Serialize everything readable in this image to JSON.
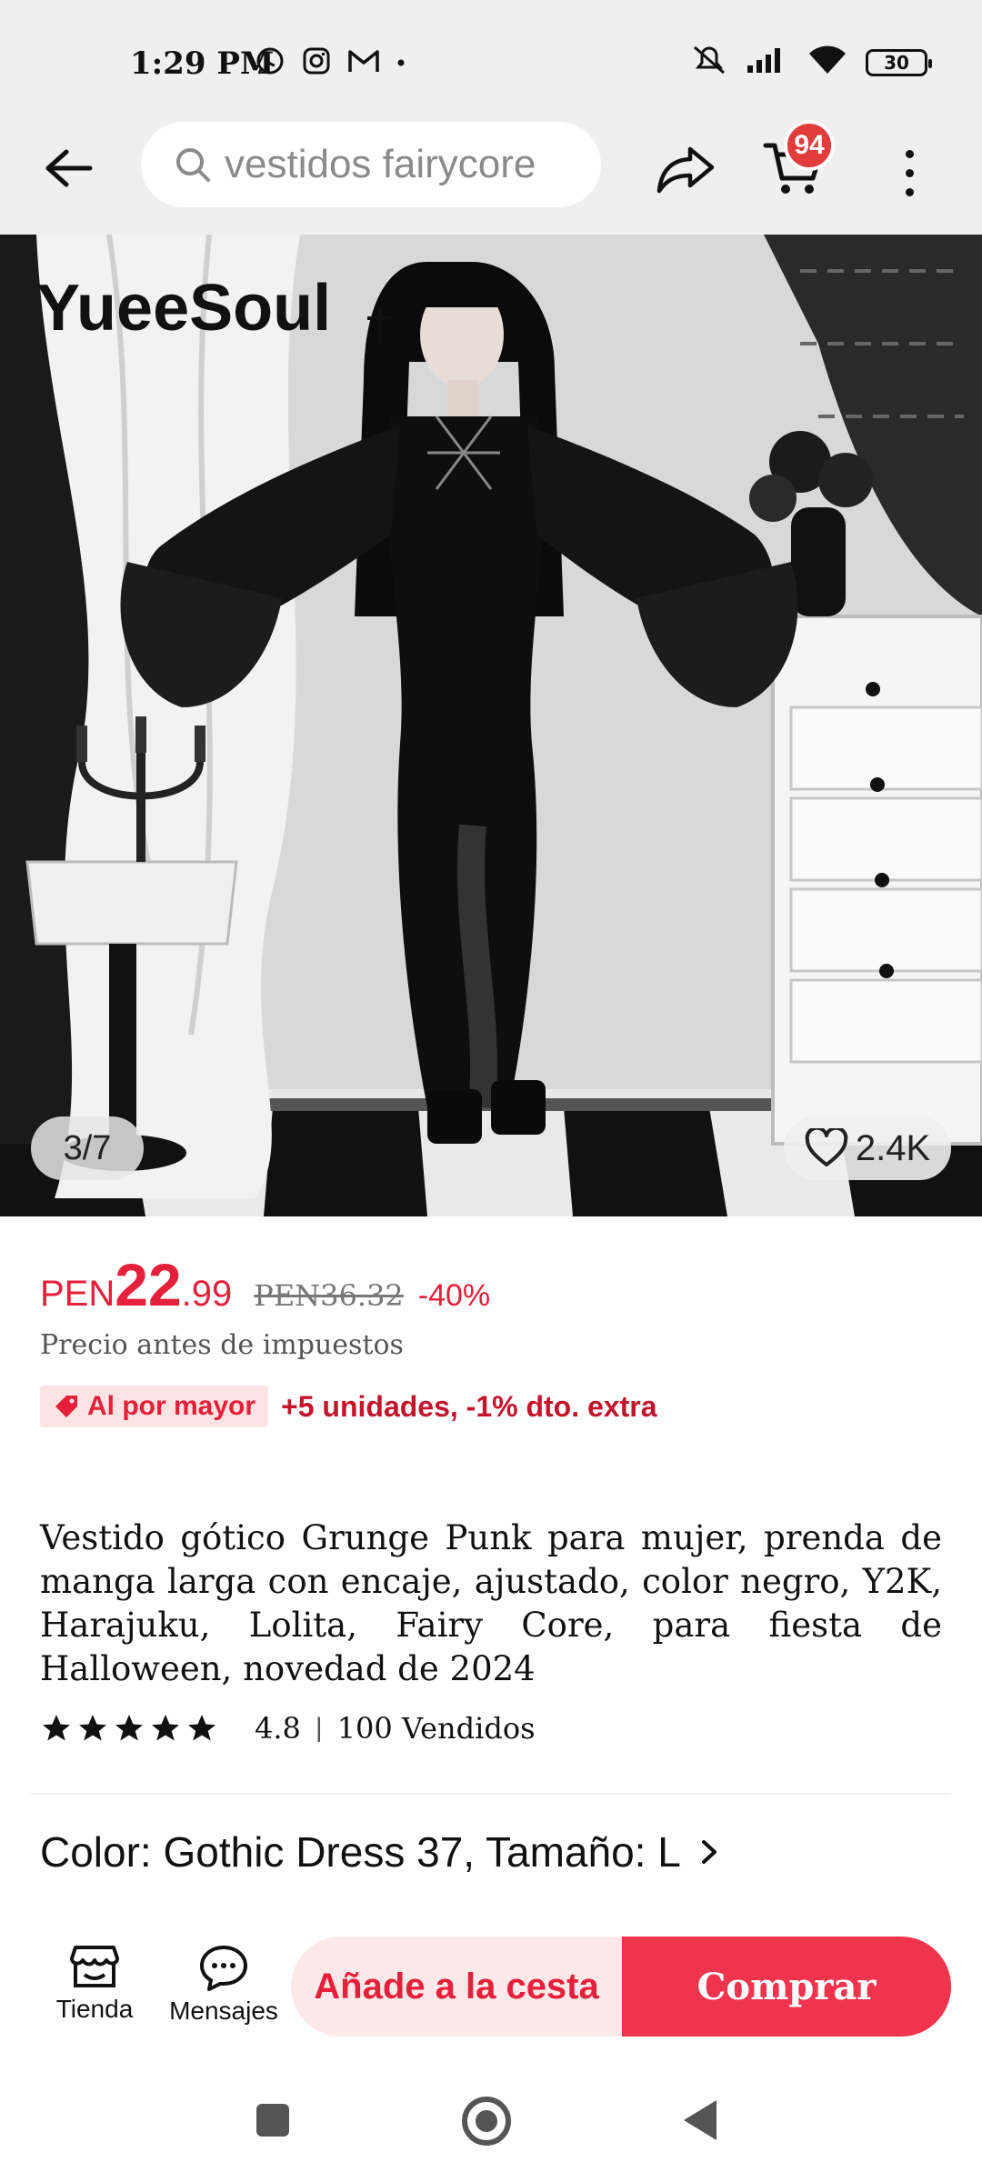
{
  "status_bar": {
    "time": "1:29 PM",
    "battery": "30",
    "apps": [
      "whatsapp-icon",
      "instagram-icon",
      "gmail-icon",
      "dot"
    ]
  },
  "header": {
    "search_text": "vestidos fairycore",
    "cart_count": "94"
  },
  "gallery": {
    "watermark": "YueeSoul",
    "counter": "3/7",
    "likes": "2.4K"
  },
  "price": {
    "currency": "PEN",
    "integer": "22",
    "decimal": ".99",
    "original": "PEN36.32",
    "discount": "-40%",
    "tax_note": "Precio antes de impuestos"
  },
  "wholesale": {
    "badge": "Al por mayor",
    "text": "+5 unidades, -1% dto. extra"
  },
  "product": {
    "title": "Vestido gótico Grunge Punk para mujer, prenda de manga larga con encaje, ajustado, color negro, Y2K, Harajuku, Lolita, Fairy Core, para fiesta de Halloween, novedad de 2024",
    "rating": "4.8",
    "sold": "100 Vendidos",
    "variant": "Color: Gothic Dress 37, Tamaño: L"
  },
  "bottom_bar": {
    "store_label": "Tienda",
    "messages_label": "Mensajes",
    "add_to_cart": "Añade a la cesta",
    "buy": "Comprar"
  },
  "colors": {
    "accent": "#e5203a",
    "cta_buy": "#f0344d",
    "cta_add_bg": "#fde8ea",
    "status_bg": "#efefef"
  }
}
